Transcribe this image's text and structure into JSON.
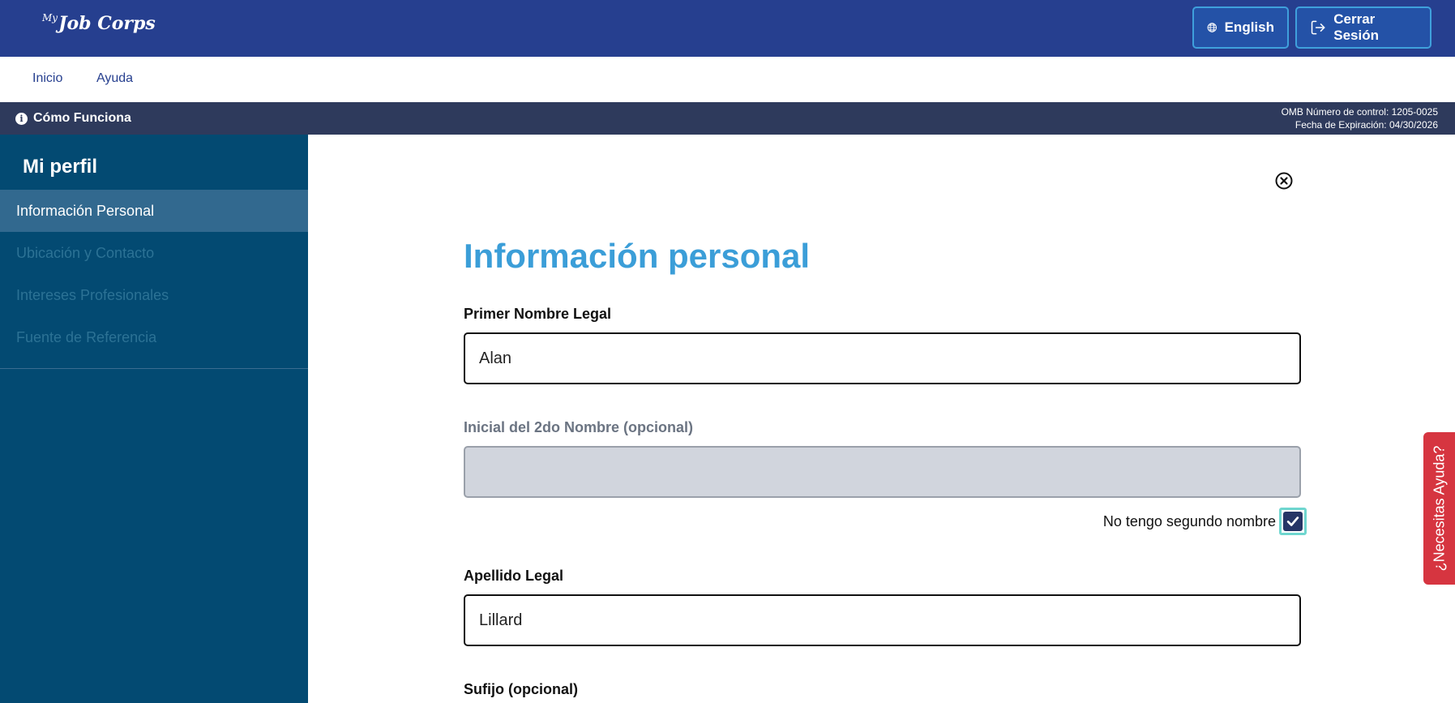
{
  "header": {
    "logo_prefix": "My",
    "logo_text": "Job Corps",
    "language_button": "English",
    "logout_button": "Cerrar Sesión"
  },
  "nav": {
    "items": [
      "Inicio",
      "Ayuda"
    ]
  },
  "infobar": {
    "how_it_works": "Cómo Funciona",
    "omb_control": "OMB Número de control: 1205-0025",
    "expiration": "Fecha de Expiración: 04/30/2026"
  },
  "sidebar": {
    "title": "Mi perfil",
    "items": [
      {
        "label": "Información Personal",
        "active": true
      },
      {
        "label": "Ubicación y Contacto",
        "active": false
      },
      {
        "label": "Intereses Profesionales",
        "active": false
      },
      {
        "label": "Fuente de Referencia",
        "active": false
      }
    ]
  },
  "form": {
    "title": "Información personal",
    "first_name": {
      "label": "Primer Nombre Legal",
      "value": "Alan"
    },
    "middle_initial": {
      "label": "Inicial del 2do Nombre (opcional)",
      "value": "",
      "disabled": true
    },
    "no_middle_name": {
      "label": "No tengo segundo nombre",
      "checked": true
    },
    "last_name": {
      "label": "Apellido Legal",
      "value": "Lillard"
    },
    "suffix": {
      "label": "Sufijo (opcional)"
    }
  },
  "help_tab": {
    "label": "¿Necesitas Ayuda?"
  },
  "colors": {
    "header_bg": "#263f8f",
    "sidebar_bg": "#034a72",
    "title_accent": "#3b9ed8",
    "help_tab": "#d63540"
  }
}
